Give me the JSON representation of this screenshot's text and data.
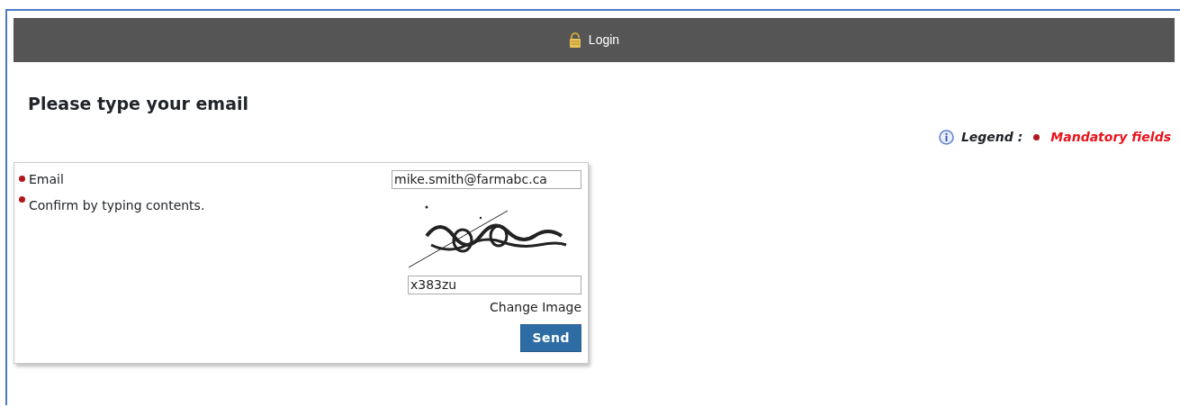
{
  "header": {
    "title": "Login"
  },
  "heading": "Please type your email",
  "legend": {
    "label": "Legend :",
    "mandatory_label": "Mandatory fields"
  },
  "form": {
    "fields": [
      {
        "kind": "text",
        "label": "Email",
        "required": true,
        "value": "mike.smith@farmabc.ca"
      },
      {
        "kind": "captcha",
        "label": "Confirm by typing contents.",
        "required": true,
        "value": "x383zu",
        "link": "Change Image"
      }
    ],
    "submit": "Send"
  }
}
